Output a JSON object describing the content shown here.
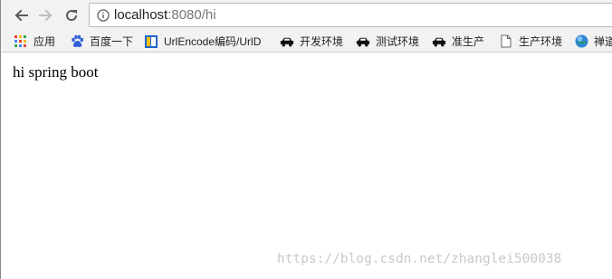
{
  "toolbar": {
    "url_host": "localhost",
    "url_rest": ":8080/hi"
  },
  "bookmarks": [
    {
      "label": "应用",
      "icon": "apps-grid-icon"
    },
    {
      "label": "百度一下",
      "icon": "baidu-paw-icon"
    },
    {
      "label": "UrlEncode编码/UrlD",
      "icon": "bookmark-page-icon"
    },
    {
      "label": "开发环境",
      "icon": "car-icon"
    },
    {
      "label": "测试环境",
      "icon": "car-icon"
    },
    {
      "label": "准生产",
      "icon": "car-icon"
    },
    {
      "label": "生产环境",
      "icon": "blank-page-icon"
    },
    {
      "label": "禅道",
      "icon": "globe-icon"
    }
  ],
  "page": {
    "text": "hi spring boot"
  },
  "watermark": {
    "text": "https://blog.csdn.net/zhanglei500038"
  },
  "colors": {
    "chrome_bg": "#f2f2f2",
    "text": "#222222",
    "url_muted": "#777777",
    "apps_colors": [
      "#ea4335",
      "#fbbc05",
      "#34a853",
      "#4285f4"
    ]
  }
}
